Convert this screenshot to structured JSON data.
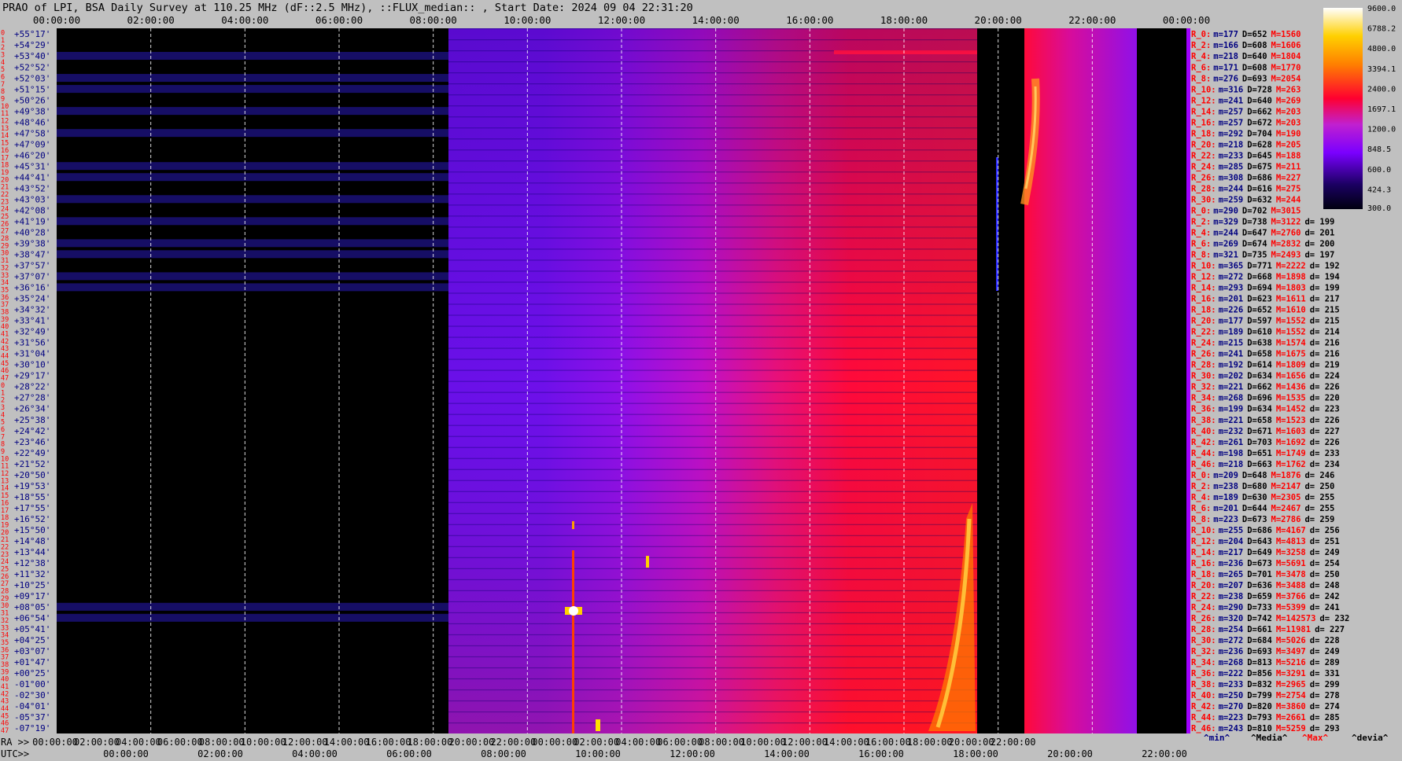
{
  "title": "PRAO of LPI, BSA Daily Survey at 110.25 MHz (dF::2.5 MHz), ::FLUX_median:: , Start Date: 2024 09 04 22:31:20",
  "chart_data": {
    "type": "heatmap",
    "title": "PRAO of LPI, BSA Daily Survey at 110.25 MHz (dF::2.5 MHz), ::FLUX_median:: , Start Date: 2024 09 04 22:31:20",
    "x_top_ticks": [
      "00:00:00",
      "02:00:00",
      "04:00:00",
      "06:00:00",
      "08:00:00",
      "10:00:00",
      "12:00:00",
      "14:00:00",
      "16:00:00",
      "18:00:00",
      "20:00:00",
      "22:00:00",
      "00:00:00"
    ],
    "ra_label": "RA >>",
    "ra_ticks": [
      "00:00:00",
      "02:00:00",
      "04:00:00",
      "06:00:00",
      "08:00:00",
      "10:00:00",
      "12:00:00",
      "14:00:00",
      "16:00:00",
      "18:00:00",
      "20:00:00",
      "22:00:00",
      "00:00:00",
      "02:00:00",
      "04:00:00",
      "06:00:00",
      "08:00:00",
      "10:00:00",
      "12:00:00",
      "14:00:00",
      "16:00:00",
      "18:00:00",
      "20:00:00",
      "22:00:00"
    ],
    "utc_label": "UTC>>",
    "utc_ticks": [
      "00:00:00",
      "02:00:00",
      "04:00:00",
      "06:00:00",
      "08:00:00",
      "10:00:00",
      "12:00:00",
      "14:00:00",
      "16:00:00",
      "18:00:00",
      "20:00:00",
      "22:00:00"
    ],
    "beam_indices": [
      "0",
      "1",
      "2",
      "3",
      "4",
      "5",
      "6",
      "7",
      "8",
      "9",
      "10",
      "11",
      "12",
      "13",
      "14",
      "15",
      "16",
      "17",
      "18",
      "19",
      "20",
      "21",
      "22",
      "23",
      "24",
      "25",
      "26",
      "27",
      "28",
      "29",
      "30",
      "31",
      "32",
      "33",
      "34",
      "35",
      "36",
      "37",
      "38",
      "39",
      "40",
      "41",
      "42",
      "43",
      "44",
      "45",
      "46",
      "47",
      "0",
      "1",
      "2",
      "3",
      "4",
      "5",
      "6",
      "7",
      "8",
      "9",
      "10",
      "11",
      "12",
      "13",
      "14",
      "15",
      "16",
      "17",
      "18",
      "19",
      "20",
      "21",
      "22",
      "23",
      "24",
      "25",
      "26",
      "27",
      "28",
      "29",
      "30",
      "31",
      "32",
      "33",
      "34",
      "35",
      "36",
      "37",
      "38",
      "39",
      "40",
      "41",
      "42",
      "43",
      "44",
      "45",
      "46",
      "47"
    ],
    "declinations": [
      "+55°17'",
      "+54°29'",
      "+53°40'",
      "+52°52'",
      "+52°03'",
      "+51°15'",
      "+50°26'",
      "+49°38'",
      "+48°46'",
      "+47°58'",
      "+47°09'",
      "+46°20'",
      "+45°31'",
      "+44°41'",
      "+43°52'",
      "+43°03'",
      "+42°08'",
      "+41°19'",
      "+40°28'",
      "+39°38'",
      "+38°47'",
      "+37°57'",
      "+37°07'",
      "+36°16'",
      "+35°24'",
      "+34°32'",
      "+33°41'",
      "+32°49'",
      "+31°56'",
      "+31°04'",
      "+30°10'",
      "+29°17'",
      "+28°22'",
      "+27°28'",
      "+26°34'",
      "+25°38'",
      "+24°42'",
      "+23°46'",
      "+22°49'",
      "+21°52'",
      "+20°50'",
      "+19°53'",
      "+18°55'",
      "+17°55'",
      "+16°52'",
      "+15°50'",
      "+14°48'",
      "+13°44'",
      "+12°38'",
      "+11°32'",
      "+10°25'",
      "+09°17'",
      "+08°05'",
      "+06°54'",
      "+05°41'",
      "+04°25'",
      "+03°07'",
      "+01°47'",
      "+00°25'",
      "-01°00'",
      "-02°30'",
      "-04°01'",
      "-05°37'",
      "-07°19'"
    ],
    "colorbar_ticks": [
      "9600.0",
      "6788.2",
      "4800.0",
      "3394.1",
      "2400.0",
      "1697.1",
      "1200.0",
      "848.5",
      "600.0",
      "424.3",
      "300.0"
    ],
    "colorbar_range": [
      300.0,
      9600.0
    ],
    "colorbar_scale": "log",
    "stats": [
      {
        "r": "R_0:",
        "m": "m=177",
        "d": "D=652",
        "mx": "M=1560",
        "dv": ""
      },
      {
        "r": "R_2:",
        "m": "m=166",
        "d": "D=608",
        "mx": "M=1606",
        "dv": ""
      },
      {
        "r": "R_4:",
        "m": "m=218",
        "d": "D=640",
        "mx": "M=1804",
        "dv": ""
      },
      {
        "r": "R_6:",
        "m": "m=171",
        "d": "D=608",
        "mx": "M=1770",
        "dv": ""
      },
      {
        "r": "R_8:",
        "m": "m=276",
        "d": "D=693",
        "mx": "M=2054",
        "dv": ""
      },
      {
        "r": "R_10:",
        "m": "m=316",
        "d": "D=728",
        "mx": "M=263",
        "dv": ""
      },
      {
        "r": "R_12:",
        "m": "m=241",
        "d": "D=640",
        "mx": "M=269",
        "dv": ""
      },
      {
        "r": "R_14:",
        "m": "m=257",
        "d": "D=662",
        "mx": "M=203",
        "dv": ""
      },
      {
        "r": "R_16:",
        "m": "m=257",
        "d": "D=672",
        "mx": "M=203",
        "dv": ""
      },
      {
        "r": "R_18:",
        "m": "m=292",
        "d": "D=704",
        "mx": "M=190",
        "dv": ""
      },
      {
        "r": "R_20:",
        "m": "m=218",
        "d": "D=628",
        "mx": "M=205",
        "dv": ""
      },
      {
        "r": "R_22:",
        "m": "m=233",
        "d": "D=645",
        "mx": "M=188",
        "dv": ""
      },
      {
        "r": "R_24:",
        "m": "m=285",
        "d": "D=675",
        "mx": "M=211",
        "dv": ""
      },
      {
        "r": "R_26:",
        "m": "m=308",
        "d": "D=686",
        "mx": "M=227",
        "dv": ""
      },
      {
        "r": "R_28:",
        "m": "m=244",
        "d": "D=616",
        "mx": "M=275",
        "dv": ""
      },
      {
        "r": "R_30:",
        "m": "m=259",
        "d": "D=632",
        "mx": "M=244",
        "dv": ""
      },
      {
        "r": "R_0:",
        "m": "m=290",
        "d": "D=702",
        "mx": "M=3015",
        "dv": ""
      },
      {
        "r": "R_2:",
        "m": "m=329",
        "d": "D=738",
        "mx": "M=3122",
        "dv": "d= 199"
      },
      {
        "r": "R_4:",
        "m": "m=244",
        "d": "D=647",
        "mx": "M=2760",
        "dv": "d= 201"
      },
      {
        "r": "R_6:",
        "m": "m=269",
        "d": "D=674",
        "mx": "M=2832",
        "dv": "d= 200"
      },
      {
        "r": "R_8:",
        "m": "m=321",
        "d": "D=735",
        "mx": "M=2493",
        "dv": "d= 197"
      },
      {
        "r": "R_10:",
        "m": "m=365",
        "d": "D=771",
        "mx": "M=2222",
        "dv": "d= 192"
      },
      {
        "r": "R_12:",
        "m": "m=272",
        "d": "D=668",
        "mx": "M=1898",
        "dv": "d= 194"
      },
      {
        "r": "R_14:",
        "m": "m=293",
        "d": "D=694",
        "mx": "M=1803",
        "dv": "d= 199"
      },
      {
        "r": "R_16:",
        "m": "m=201",
        "d": "D=623",
        "mx": "M=1611",
        "dv": "d= 217"
      },
      {
        "r": "R_18:",
        "m": "m=226",
        "d": "D=652",
        "mx": "M=1610",
        "dv": "d= 215"
      },
      {
        "r": "R_20:",
        "m": "m=177",
        "d": "D=597",
        "mx": "M=1552",
        "dv": "d= 215"
      },
      {
        "r": "R_22:",
        "m": "m=189",
        "d": "D=610",
        "mx": "M=1552",
        "dv": "d= 214"
      },
      {
        "r": "R_24:",
        "m": "m=215",
        "d": "D=638",
        "mx": "M=1574",
        "dv": "d= 216"
      },
      {
        "r": "R_26:",
        "m": "m=241",
        "d": "D=658",
        "mx": "M=1675",
        "dv": "d= 216"
      },
      {
        "r": "R_28:",
        "m": "m=192",
        "d": "D=614",
        "mx": "M=1809",
        "dv": "d= 219"
      },
      {
        "r": "R_30:",
        "m": "m=202",
        "d": "D=634",
        "mx": "M=1656",
        "dv": "d= 224"
      },
      {
        "r": "R_32:",
        "m": "m=221",
        "d": "D=662",
        "mx": "M=1436",
        "dv": "d= 226"
      },
      {
        "r": "R_34:",
        "m": "m=268",
        "d": "D=696",
        "mx": "M=1535",
        "dv": "d= 220"
      },
      {
        "r": "R_36:",
        "m": "m=199",
        "d": "D=634",
        "mx": "M=1452",
        "dv": "d= 223"
      },
      {
        "r": "R_38:",
        "m": "m=221",
        "d": "D=658",
        "mx": "M=1523",
        "dv": "d= 226"
      },
      {
        "r": "R_40:",
        "m": "m=232",
        "d": "D=671",
        "mx": "M=1603",
        "dv": "d= 227"
      },
      {
        "r": "R_42:",
        "m": "m=261",
        "d": "D=703",
        "mx": "M=1692",
        "dv": "d= 226"
      },
      {
        "r": "R_44:",
        "m": "m=198",
        "d": "D=651",
        "mx": "M=1749",
        "dv": "d= 233"
      },
      {
        "r": "R_46:",
        "m": "m=218",
        "d": "D=663",
        "mx": "M=1762",
        "dv": "d= 234"
      },
      {
        "r": "R_0:",
        "m": "m=209",
        "d": "D=648",
        "mx": "M=1876",
        "dv": "d= 246"
      },
      {
        "r": "R_2:",
        "m": "m=238",
        "d": "D=680",
        "mx": "M=2147",
        "dv": "d= 250"
      },
      {
        "r": "R_4:",
        "m": "m=189",
        "d": "D=630",
        "mx": "M=2305",
        "dv": "d= 255"
      },
      {
        "r": "R_6:",
        "m": "m=201",
        "d": "D=644",
        "mx": "M=2467",
        "dv": "d= 255"
      },
      {
        "r": "R_8:",
        "m": "m=223",
        "d": "D=673",
        "mx": "M=2786",
        "dv": "d= 259"
      },
      {
        "r": "R_10:",
        "m": "m=255",
        "d": "D=686",
        "mx": "M=4167",
        "dv": "d= 256"
      },
      {
        "r": "R_12:",
        "m": "m=204",
        "d": "D=643",
        "mx": "M=4813",
        "dv": "d= 251"
      },
      {
        "r": "R_14:",
        "m": "m=217",
        "d": "D=649",
        "mx": "M=3258",
        "dv": "d= 249"
      },
      {
        "r": "R_16:",
        "m": "m=236",
        "d": "D=673",
        "mx": "M=5691",
        "dv": "d= 254"
      },
      {
        "r": "R_18:",
        "m": "m=265",
        "d": "D=701",
        "mx": "M=3478",
        "dv": "d= 250"
      },
      {
        "r": "R_20:",
        "m": "m=207",
        "d": "D=636",
        "mx": "M=3488",
        "dv": "d= 248"
      },
      {
        "r": "R_22:",
        "m": "m=238",
        "d": "D=659",
        "mx": "M=3766",
        "dv": "d= 242"
      },
      {
        "r": "R_24:",
        "m": "m=290",
        "d": "D=733",
        "mx": "M=5399",
        "dv": "d= 241"
      },
      {
        "r": "R_26:",
        "m": "m=320",
        "d": "D=742",
        "mx": "M=142573",
        "dv": "d= 232"
      },
      {
        "r": "R_28:",
        "m": "m=254",
        "d": "D=661",
        "mx": "M=11981",
        "dv": "d= 227"
      },
      {
        "r": "R_30:",
        "m": "m=272",
        "d": "D=684",
        "mx": "M=5026",
        "dv": "d= 228"
      },
      {
        "r": "R_32:",
        "m": "m=236",
        "d": "D=693",
        "mx": "M=3497",
        "dv": "d= 249"
      },
      {
        "r": "R_34:",
        "m": "m=268",
        "d": "D=813",
        "mx": "M=5216",
        "dv": "d= 289"
      },
      {
        "r": "R_36:",
        "m": "m=222",
        "d": "D=856",
        "mx": "M=3291",
        "dv": "d= 331"
      },
      {
        "r": "R_38:",
        "m": "m=233",
        "d": "D=832",
        "mx": "M=2965",
        "dv": "d= 299"
      },
      {
        "r": "R_40:",
        "m": "m=250",
        "d": "D=799",
        "mx": "M=2754",
        "dv": "d= 278"
      },
      {
        "r": "R_42:",
        "m": "m=270",
        "d": "D=820",
        "mx": "M=3860",
        "dv": "d= 274"
      },
      {
        "r": "R_44:",
        "m": "m=223",
        "d": "D=793",
        "mx": "M=2661",
        "dv": "d= 285"
      },
      {
        "r": "R_46:",
        "m": "m=243",
        "d": "D=810",
        "mx": "M=5259",
        "dv": "d= 293"
      }
    ],
    "legend_keys": [
      "^min^",
      "^Media^",
      "^Max^",
      "^devia^"
    ]
  },
  "colors": {
    "background": "#c0c0c0",
    "plot_black": "#000000",
    "red_text": "#ff0000",
    "blue_text": "#000080",
    "grid": "#ffffff"
  }
}
